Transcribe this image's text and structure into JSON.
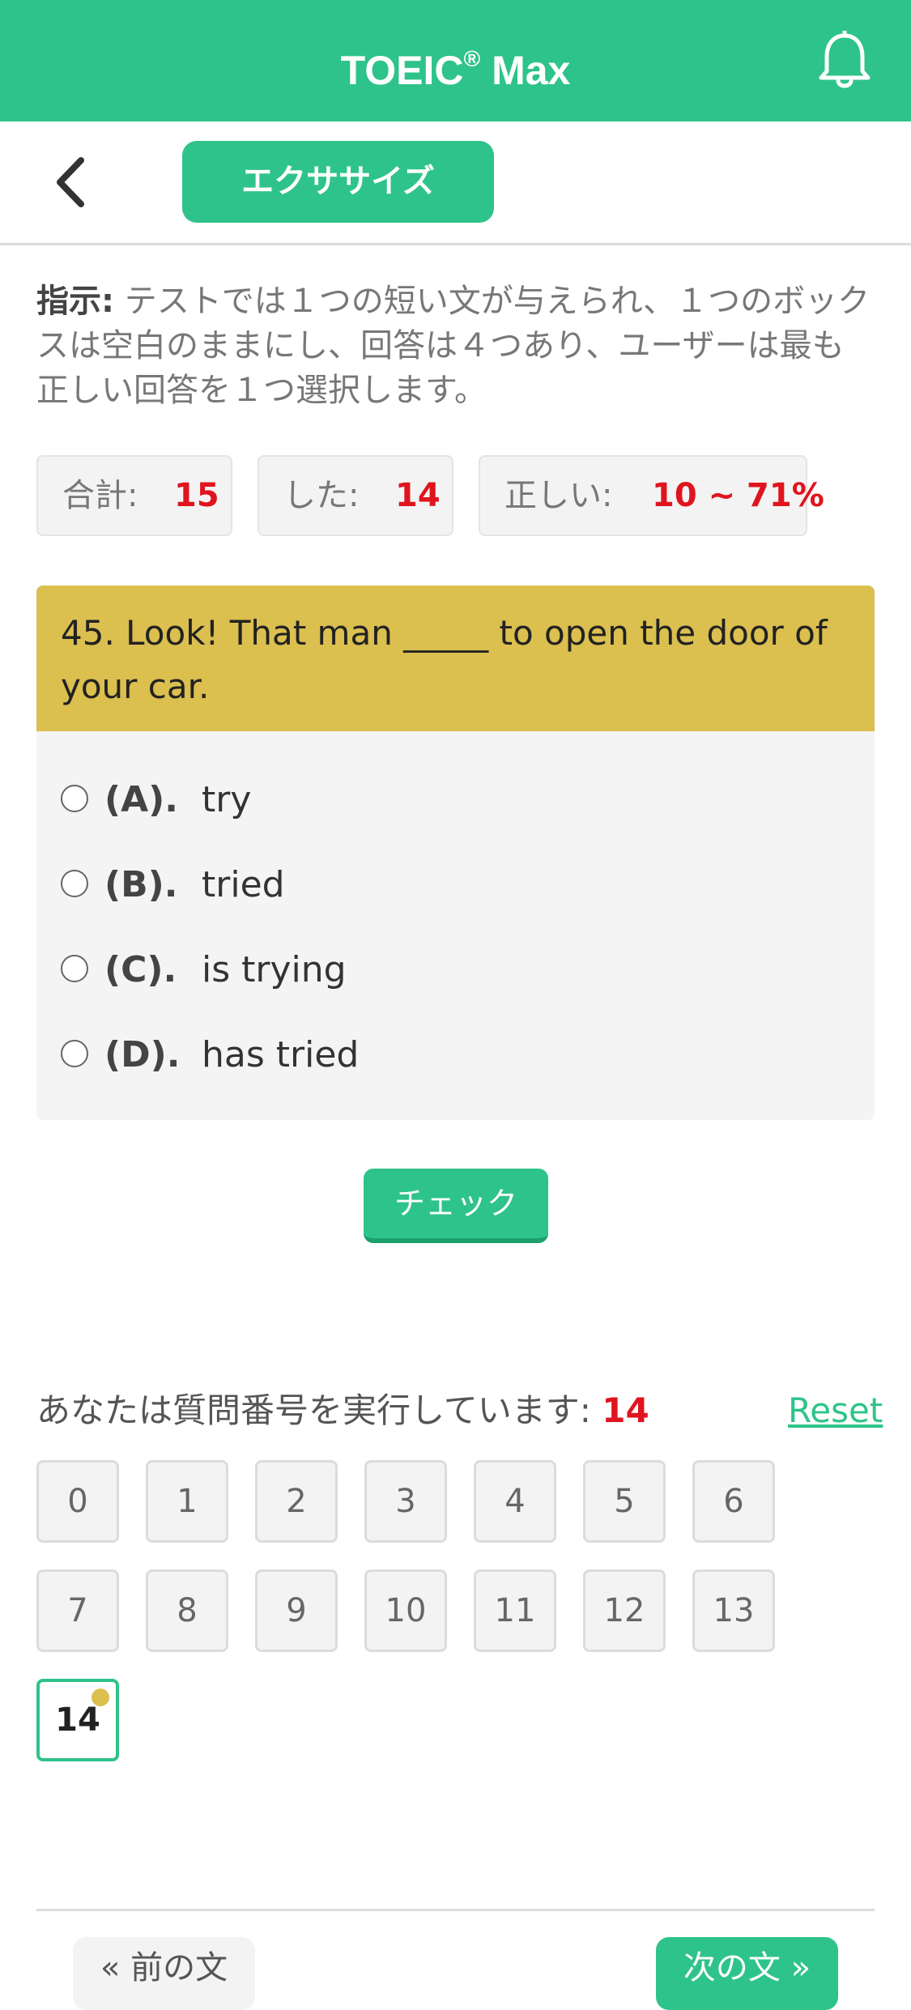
{
  "header": {
    "app_name": "TOEIC",
    "app_registered": "®",
    "app_suffix": " Max",
    "bell_icon": "bell-icon",
    "accent_color": "#2ec38a"
  },
  "subheader": {
    "back_icon": "chevron-left-icon",
    "tab_label": "エクササイズ"
  },
  "instructions": {
    "label": "指示:",
    "text": " テストでは１つの短い文が与えられ、１つのボックスは空白のままにし、回答は４つあり、ユーザーは最も正しい回答を１つ選択します。"
  },
  "stats": {
    "total_label": "合計:",
    "total_value": "15",
    "done_label": "した:",
    "done_value": "14",
    "correct_label": "正しい:",
    "correct_value": "10 ~ 71%"
  },
  "question": {
    "text": "45. Look! That man _____ to open the door of your car.",
    "header_color": "#dbbf4f",
    "options": [
      {
        "letter": "(A).",
        "text": "try"
      },
      {
        "letter": "(B).",
        "text": "tried"
      },
      {
        "letter": "(C).",
        "text": "is trying"
      },
      {
        "letter": "(D).",
        "text": "has tried"
      }
    ]
  },
  "check_button": "チェック",
  "progress": {
    "label": "あなたは質問番号を実行しています:",
    "current": "14",
    "reset": "Reset",
    "numbers": [
      "0",
      "1",
      "2",
      "3",
      "4",
      "5",
      "6",
      "7",
      "8",
      "9",
      "10",
      "11",
      "12",
      "13",
      "14"
    ]
  },
  "nav": {
    "prev": "« 前の文",
    "next": "次の文 »"
  }
}
